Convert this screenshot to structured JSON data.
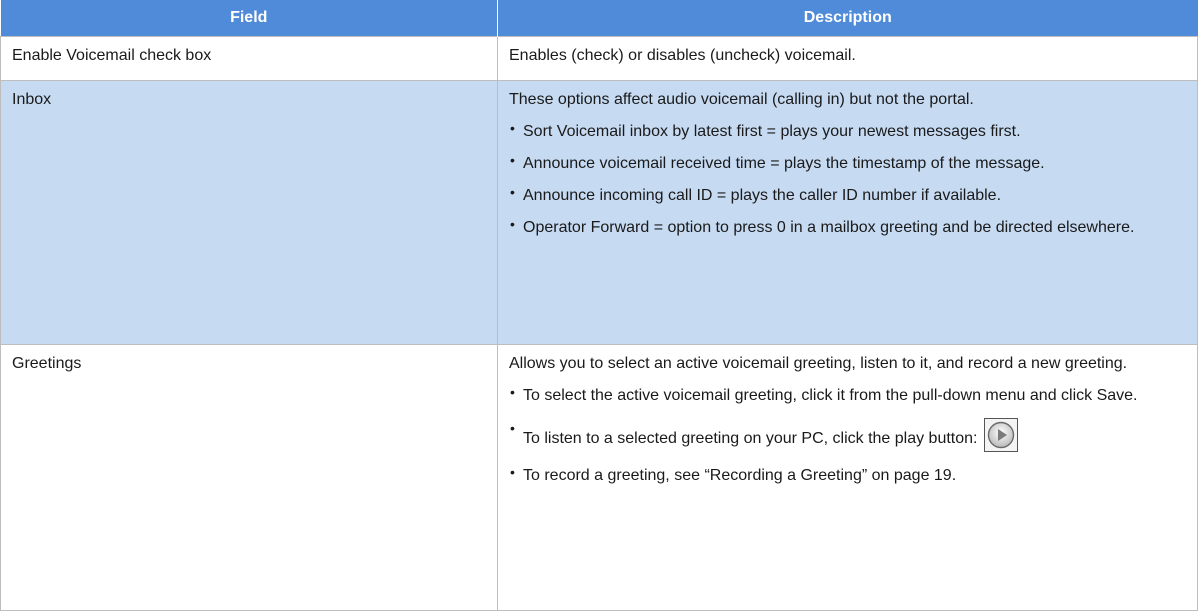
{
  "table": {
    "headers": {
      "field": "Field",
      "description": "Description"
    },
    "rows": [
      {
        "field": "Enable Voicemail check box",
        "description": "Enables (check) or disables (uncheck) voicemail."
      },
      {
        "field": "Inbox",
        "description": "These options affect audio voicemail (calling in) but not the portal.",
        "bullets": [
          "Sort Voicemail inbox by latest first = plays your newest messages first.",
          "Announce voicemail received time = plays the timestamp of the message.",
          "Announce incoming call ID = plays the caller ID number if available.",
          "Operator Forward = option to press 0 in a mailbox greeting and be directed elsewhere."
        ]
      },
      {
        "field": "Greetings",
        "description": "Allows you to select an active voicemail greeting, listen to it, and record a new greeting.",
        "bullets": [
          "To select the active voicemail greeting, click it from the pull-down menu and click Save.",
          "To listen to a selected greeting on your PC, click the play button:",
          "To record a greeting, see “Recording a Greeting” on page 19."
        ]
      }
    ]
  },
  "icons": {
    "play": "play-button-icon"
  },
  "colors": {
    "header_bg": "#4f8bd9",
    "shaded_row_bg": "#c6daf2"
  }
}
